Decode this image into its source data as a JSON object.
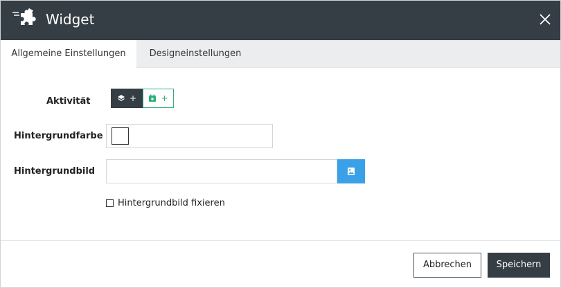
{
  "dialog": {
    "title": "Widget",
    "logo_icon": "puzzle-widget-icon",
    "close_icon": "close-icon"
  },
  "tabs": [
    {
      "label": "Allgemeine Einstellungen",
      "active": true
    },
    {
      "label": "Designeinstellungen",
      "active": false
    }
  ],
  "form": {
    "activity": {
      "label": "Aktivität",
      "buttons": [
        {
          "icon": "layers-icon",
          "text": "+"
        },
        {
          "icon": "calendar-add-icon",
          "text": "+"
        }
      ]
    },
    "background_color": {
      "label": "Hintergrundfarbe",
      "value": "#ffffff"
    },
    "background_image": {
      "label": "Hintergrundbild",
      "value": "",
      "button_icon": "image-icon"
    },
    "fix_background": {
      "label": "Hintergrundbild fixieren",
      "checked": false
    }
  },
  "footer": {
    "cancel_label": "Abbrechen",
    "save_label": "Speichern"
  },
  "colors": {
    "header_bg": "#353d45",
    "accent_green": "#2fb07c",
    "accent_blue": "#3aa0e8",
    "tab_bar_bg": "#ecedef"
  }
}
